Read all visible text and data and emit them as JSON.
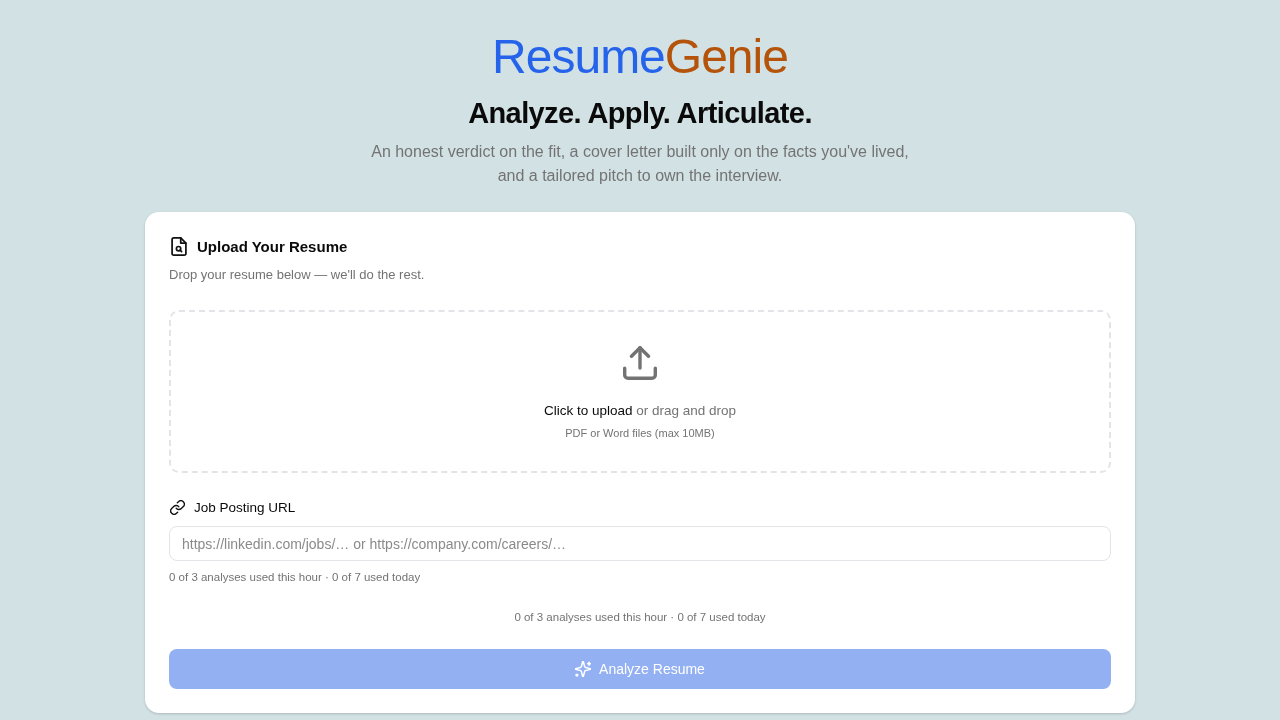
{
  "logo": {
    "parts": [
      {
        "text": "Resume",
        "color": "#2563eb"
      },
      {
        "text": "Genie",
        "color": "#b45309"
      }
    ]
  },
  "tagline": "Analyze. Apply. Articulate.",
  "intro": "An honest verdict on the fit, a cover letter built only on the facts you've lived, and a tailored pitch to own the interview.",
  "upload_card": {
    "title": "Upload Your Resume",
    "subtitle": "Drop your resume below — we'll do the rest.",
    "dropzone": {
      "link": "Click to upload",
      "prompt": "or drag and drop",
      "hint": "PDF or Word files (max 10MB)"
    },
    "job_url": {
      "label": "Job Posting URL",
      "placeholder": "https://linkedin.com/jobs/… or https://company.com/careers/…",
      "usage": "0 of 3 analyses used this hour · 0 of 7 used today"
    },
    "usage_summary": "0 of 3 analyses used this hour · 0 of 7 used today",
    "analyze_button": {
      "label": "Analyze Resume",
      "disabled": true
    }
  }
}
